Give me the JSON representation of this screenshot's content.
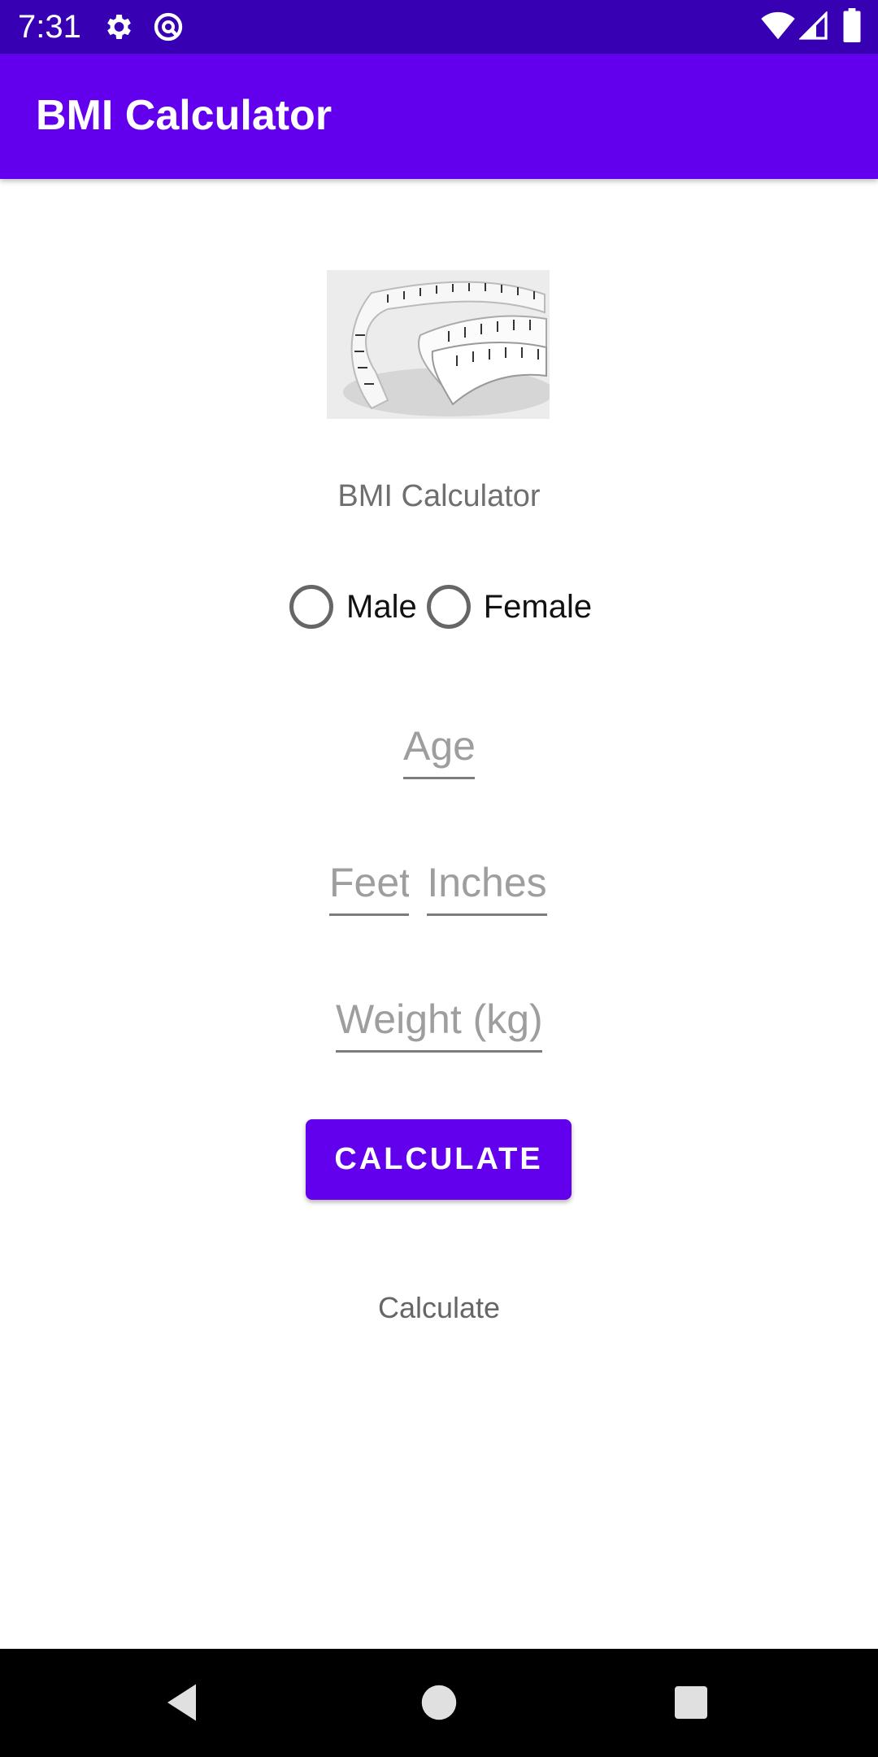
{
  "status_bar": {
    "time": "7:31",
    "icons": [
      "settings-icon",
      "sync-icon",
      "wifi-icon",
      "signal-icon",
      "battery-icon"
    ]
  },
  "app_bar": {
    "title": "BMI Calculator",
    "color": "#6200ee"
  },
  "header_image": {
    "icon": "measuring-tape-image"
  },
  "subtitle": "BMI Calculator",
  "gender": {
    "options": [
      {
        "label": "Male",
        "selected": false
      },
      {
        "label": "Female",
        "selected": false
      }
    ]
  },
  "form": {
    "age_placeholder": "Age",
    "feet_placeholder": "Feet",
    "inches_placeholder": "Inches",
    "weight_placeholder": "Weight (kg)"
  },
  "calculate_button": {
    "label": "CALCULATE",
    "color": "#6200ee"
  },
  "result_text": "Calculate",
  "nav_bar": {
    "icons": [
      "back-icon",
      "home-icon",
      "recents-icon"
    ]
  }
}
